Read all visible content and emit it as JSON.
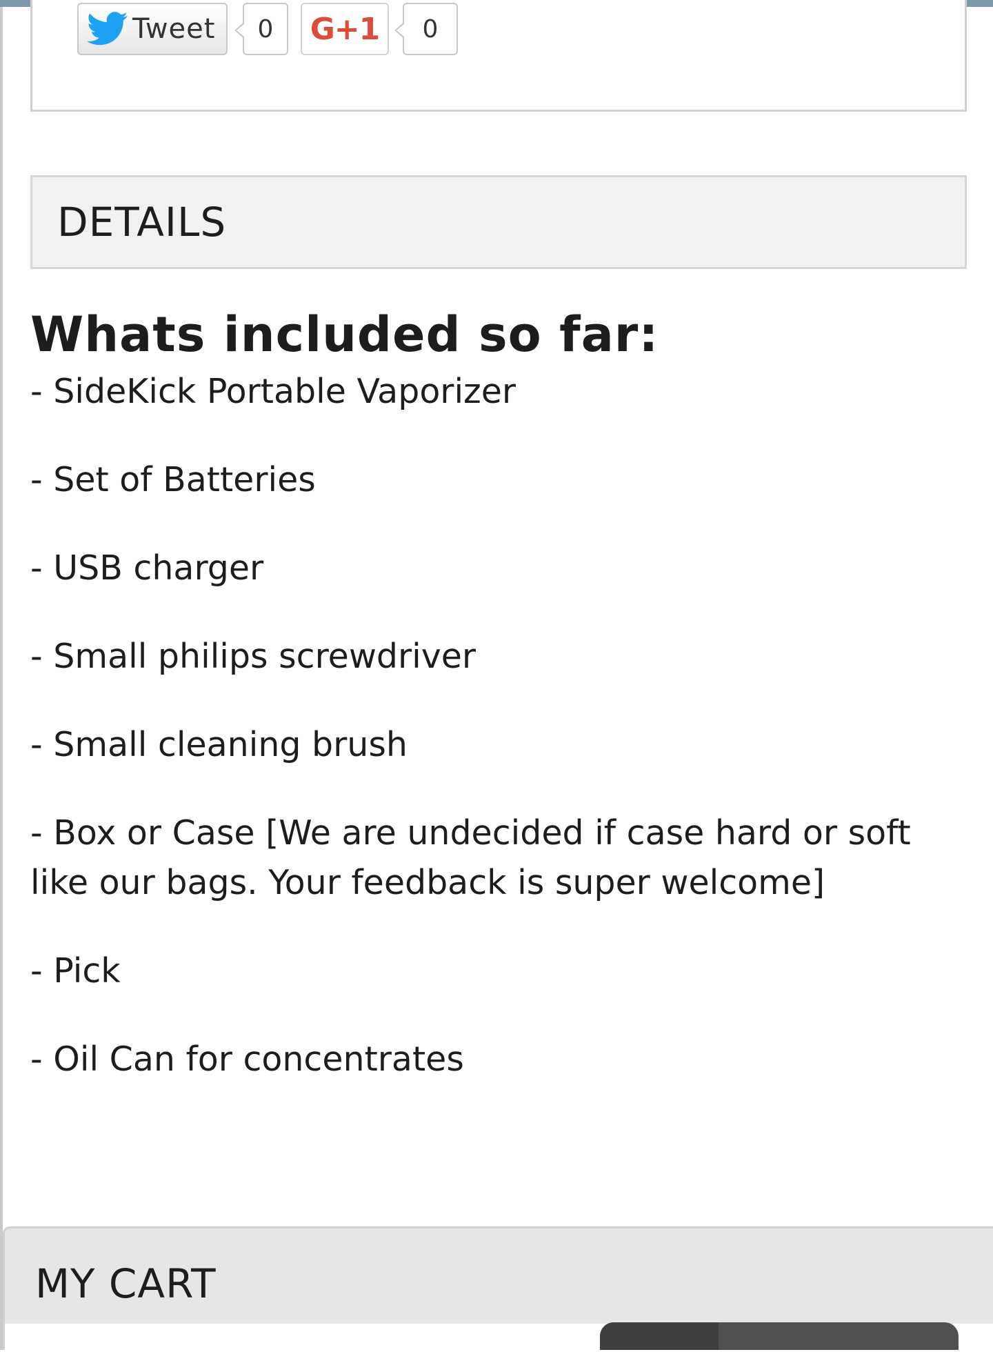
{
  "share": {
    "tweet_label": "Tweet",
    "tweet_count": "0",
    "gplus_label": "G+1",
    "gplus_count": "0"
  },
  "details": {
    "title": "DETAILS"
  },
  "content": {
    "heading": "Whats included so far:",
    "items": [
      "- SideKick Portable Vaporizer",
      "- Set of Batteries",
      "- USB charger",
      "- Small philips screwdriver",
      "- Small cleaning brush",
      "- Box or Case [We are undecided if case hard or soft like our bags. Your feedback is super welcome]",
      "- Pick",
      "- Oil Can for concentrates"
    ]
  },
  "cart": {
    "title": "MY CART"
  },
  "colors": {
    "top_strip": "#7e99a8",
    "twitter_blue": "#1da1f2",
    "gplus_red": "#dd4b39",
    "panel_gray": "#f1f1f1",
    "cart_gray": "#e6e6e6"
  },
  "icons": {
    "tweet": "twitter-bird-icon"
  }
}
